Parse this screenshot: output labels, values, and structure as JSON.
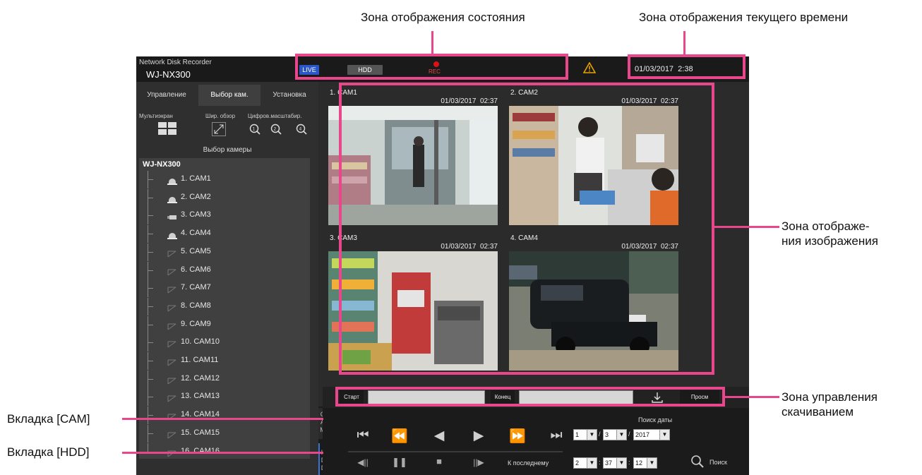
{
  "callouts": {
    "status_zone": "Зона отображения состояния",
    "time_zone": "Зона отображения текущего времени",
    "image_zone_1": "Зона отображе-",
    "image_zone_2": "ния изображения",
    "download_zone_1": "Зона управления",
    "download_zone_2": "скачиванием",
    "cam_tab": "Вкладка [CAM]",
    "hdd_tab": "Вкладка [HDD]"
  },
  "app": {
    "brand_line1": "Network Disk Recorder",
    "brand_line2": "WJ-NX300",
    "status": {
      "live": "LIVE",
      "hdd": "HDD",
      "rec": "REC"
    },
    "warning_icon": "warning-icon",
    "current_time": "01/03/2017  2:38"
  },
  "tabs": [
    "Управление",
    "Выбор кам.",
    "Установка"
  ],
  "tools": {
    "multiscreen": "Мультиэкран",
    "wide_view": "Шир. обзор",
    "digital_zoom": "Цифров.масштабир.",
    "camera_select": "Выбор камеры"
  },
  "tree": {
    "root": "WJ-NX300",
    "cameras": [
      {
        "label": "1. CAM1",
        "icon": "dome-camera-icon"
      },
      {
        "label": "2. CAM2",
        "icon": "dome-camera-icon"
      },
      {
        "label": "3. CAM3",
        "icon": "box-camera-icon"
      },
      {
        "label": "4. CAM4",
        "icon": "dome-camera-icon"
      },
      {
        "label": "5. CAM5",
        "icon": "empty-camera-icon"
      },
      {
        "label": "6. CAM6",
        "icon": "empty-camera-icon"
      },
      {
        "label": "7. CAM7",
        "icon": "empty-camera-icon"
      },
      {
        "label": "8. CAM8",
        "icon": "empty-camera-icon"
      },
      {
        "label": "9. CAM9",
        "icon": "empty-camera-icon"
      },
      {
        "label": "10. CAM10",
        "icon": "empty-camera-icon"
      },
      {
        "label": "11. CAM11",
        "icon": "empty-camera-icon"
      },
      {
        "label": "12. CAM12",
        "icon": "empty-camera-icon"
      },
      {
        "label": "13. CAM13",
        "icon": "empty-camera-icon"
      },
      {
        "label": "14. CAM14",
        "icon": "empty-camera-icon"
      },
      {
        "label": "15. CAM15",
        "icon": "empty-camera-icon"
      },
      {
        "label": "16. CAM16",
        "icon": "empty-camera-icon"
      }
    ]
  },
  "side_tabs": {
    "cam": "CAM",
    "hdd": "HDD"
  },
  "tiles": [
    {
      "name": "1. CAM1",
      "time": "01/03/2017  02:37"
    },
    {
      "name": "2. CAM2",
      "time": "01/03/2017  02:37"
    },
    {
      "name": "3. CAM3",
      "time": "01/03/2017  02:37"
    },
    {
      "name": "4. CAM4",
      "time": "01/03/2017  02:37"
    }
  ],
  "download": {
    "start": "Старт",
    "end": "Конец",
    "view": "Просм"
  },
  "playback": {
    "to_last": "К последнему",
    "date_search": "Поиск даты",
    "search": "Поиск",
    "date": {
      "month": "1",
      "day": "3",
      "year": "2017"
    },
    "time": {
      "hour": "2",
      "minute": "37",
      "second": "12"
    }
  },
  "colors": {
    "accent_pink": "#e8478b",
    "rec_red": "#e0101a",
    "warning_orange": "#e8a200",
    "live_blue": "#2a56c6"
  }
}
